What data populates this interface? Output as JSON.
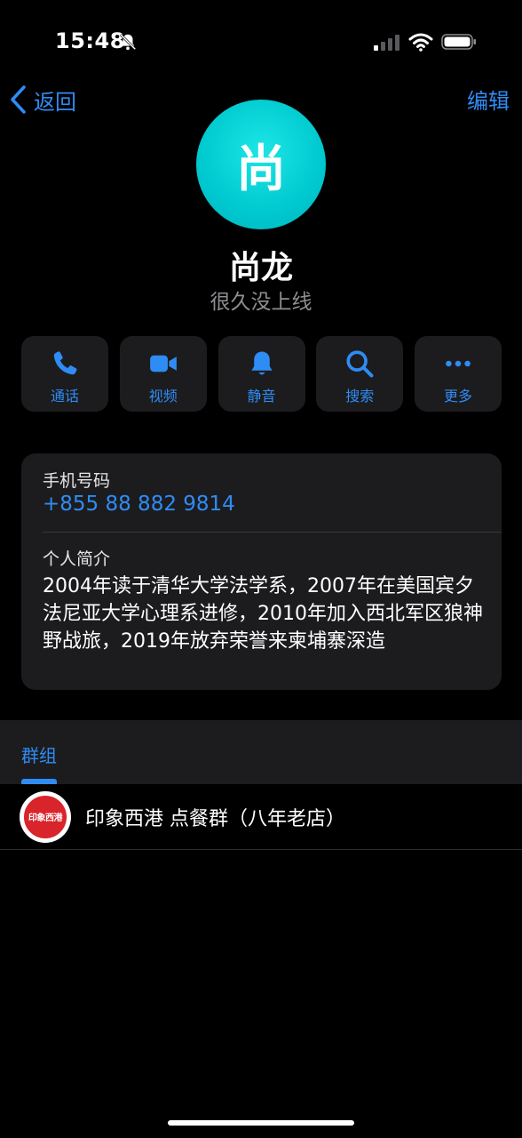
{
  "status_bar": {
    "time": "15:48"
  },
  "nav": {
    "back_label": "返回",
    "edit_label": "编辑"
  },
  "profile": {
    "avatar_char": "尚",
    "name": "尚龙",
    "last_seen": "很久没上线"
  },
  "actions": [
    {
      "label": "通话",
      "icon": "phone-icon"
    },
    {
      "label": "视频",
      "icon": "video-icon"
    },
    {
      "label": "静音",
      "icon": "bell-icon"
    },
    {
      "label": "搜索",
      "icon": "search-icon"
    },
    {
      "label": "更多",
      "icon": "more-icon"
    }
  ],
  "info": {
    "phone_label": "手机号码",
    "phone_value": "+855 88 882 9814",
    "bio_label": "个人简介",
    "bio_value": "2004年读于清华大学法学系，2007年在美国宾夕法尼亚大学心理系进修，2010年加入西北军区狼神野战旅，2019年放弃荣誉来柬埔寨深造"
  },
  "groups": {
    "title": "群组",
    "items": [
      {
        "name": "印象西港 点餐群（八年老店）",
        "avatar_text": "印象西港"
      }
    ]
  },
  "colors": {
    "accent": "#2f8cf5",
    "avatar": "#00c9cf",
    "card": "#1c1c1e"
  }
}
